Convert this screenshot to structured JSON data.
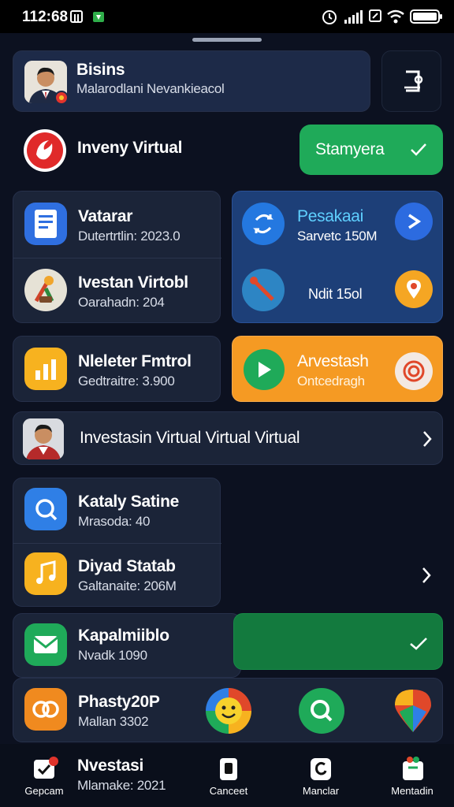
{
  "status": {
    "time": "1‌2:68",
    "time_display": "112:68"
  },
  "profile": {
    "name": "Bisins",
    "subtitle": "Malarodlani Nevankieacol"
  },
  "virtual": {
    "label": "Inveny Virtual",
    "button_label": "Stamyera"
  },
  "grid1": {
    "item1": {
      "title": "Vatarar",
      "sub": "Dutertrtlin: 2023.0"
    },
    "item2": {
      "title": "Ivestan Virtobl",
      "sub": "Oarahadn: 204"
    },
    "right": {
      "title": "Pesakaai",
      "sub": "Sarvetc 150M",
      "value": "Ndit 15ol"
    }
  },
  "grid2": {
    "left": {
      "title": "Nleleter Fmtrol",
      "sub": "Gedtraitre: 3.900"
    },
    "right": {
      "title": "Arvestash",
      "sub": "Ontcedragh"
    }
  },
  "banner": {
    "label": "Investasin Virtual Virtual Virtual"
  },
  "list2": {
    "item1": {
      "title": "Kataly Satine",
      "sub": "Mrasoda: 40"
    },
    "item2": {
      "title": "Diyad Statab",
      "sub": "Galtanaite: 206M"
    }
  },
  "row_kapal": {
    "title": "Kapalmiiblo",
    "sub": "Nvadk 1090"
  },
  "row_phasty": {
    "title": "Phasty20P",
    "sub": "Mallan 3302"
  },
  "row_nvestasi": {
    "title": "Nvestasi",
    "sub": "Mlamake: 2021"
  },
  "nav": {
    "items": [
      {
        "label": "Gepcam"
      },
      {
        "label": "Canceet"
      },
      {
        "label": "Manclar"
      },
      {
        "label": "Mentadin"
      }
    ]
  },
  "colors": {
    "bg": "#0c1120",
    "card": "#1b2438",
    "green": "#1faa59",
    "blue_card": "#1d3f78",
    "orange": "#f59a23"
  }
}
